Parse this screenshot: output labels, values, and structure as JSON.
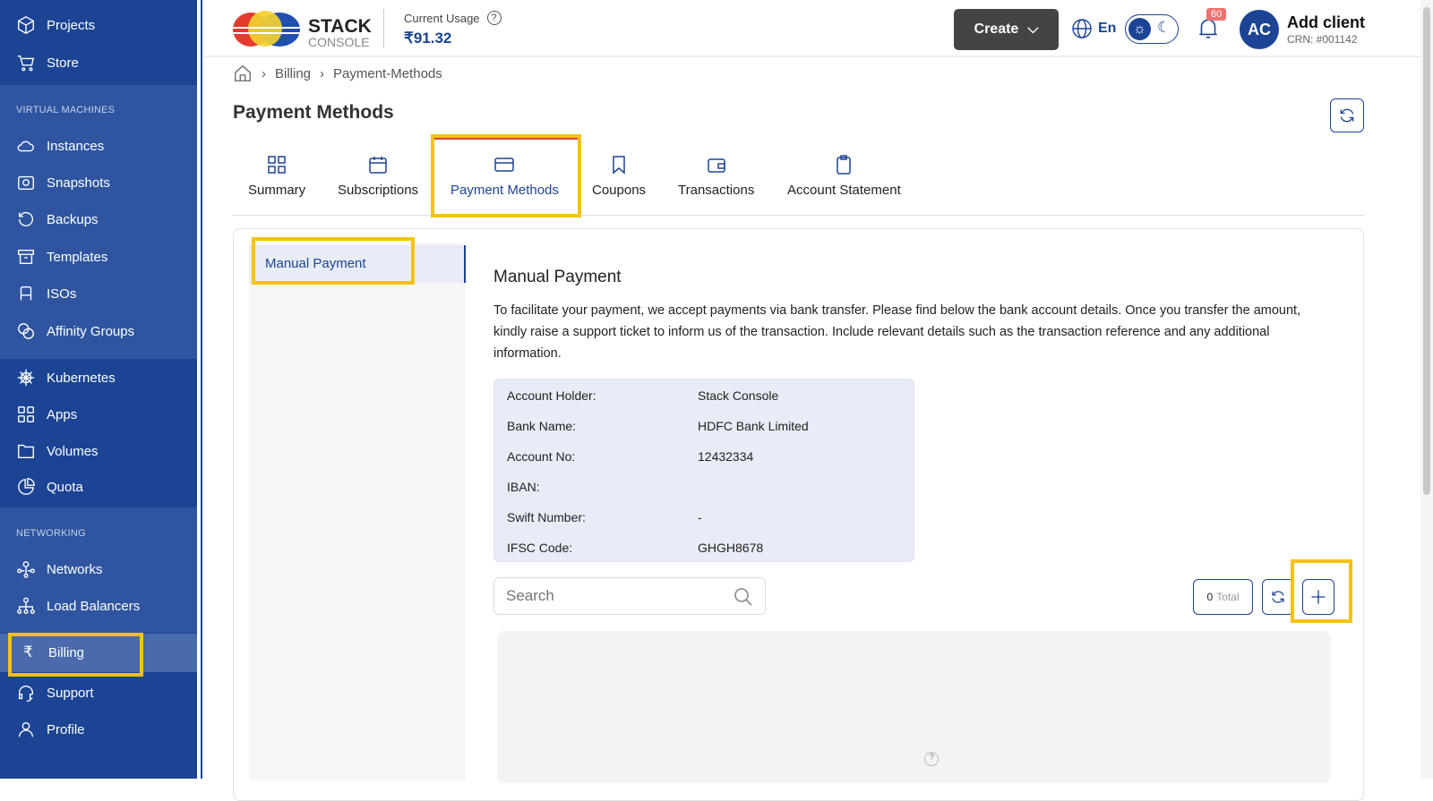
{
  "sidebar": {
    "top_items": [
      {
        "label": "Projects",
        "icon": "cube-icon"
      },
      {
        "label": "Store",
        "icon": "cart-icon"
      }
    ],
    "vm_header": "VIRTUAL MACHINES",
    "vm_items": [
      {
        "label": "Instances"
      },
      {
        "label": "Snapshots"
      },
      {
        "label": "Backups"
      },
      {
        "label": "Templates"
      },
      {
        "label": "ISOs"
      },
      {
        "label": "Affinity Groups"
      }
    ],
    "mid_items": [
      {
        "label": "Kubernetes"
      },
      {
        "label": "Apps"
      },
      {
        "label": "Volumes"
      },
      {
        "label": "Quota"
      }
    ],
    "net_header": "NETWORKING",
    "net_items": [
      {
        "label": "Networks"
      },
      {
        "label": "Load Balancers"
      }
    ],
    "bottom_items": [
      {
        "label": "Billing"
      },
      {
        "label": "Support"
      },
      {
        "label": "Profile"
      }
    ]
  },
  "header": {
    "logo_line1": "STACK",
    "logo_line2": "CONSOLE",
    "usage_label": "Current Usage",
    "usage_value": "₹91.32",
    "create_label": "Create",
    "language": "En",
    "notification_count": "60",
    "avatar_initials": "AC",
    "user_name": "Add client",
    "crn": "CRN: #001142"
  },
  "breadcrumb": [
    "Billing",
    "Payment-Methods"
  ],
  "page_title": "Payment Methods",
  "tabs": [
    {
      "label": "Summary"
    },
    {
      "label": "Subscriptions"
    },
    {
      "label": "Payment Methods"
    },
    {
      "label": "Coupons"
    },
    {
      "label": "Transactions"
    },
    {
      "label": "Account Statement"
    }
  ],
  "side_menu": {
    "item": "Manual Payment"
  },
  "content": {
    "title": "Manual Payment",
    "description": "To facilitate your payment, we accept payments via bank transfer. Please find below the bank account details. Once you transfer the amount, kindly raise a support ticket to inform us of the transaction. Include relevant details such as the transaction reference and any additional information.",
    "bank": [
      {
        "label": "Account Holder:",
        "value": "Stack Console"
      },
      {
        "label": "Bank Name:",
        "value": "HDFC Bank Limited"
      },
      {
        "label": "Account No:",
        "value": "12432334"
      },
      {
        "label": "IBAN:",
        "value": ""
      },
      {
        "label": "Swift Number:",
        "value": "-"
      },
      {
        "label": "IFSC Code:",
        "value": "GHGH8678"
      }
    ],
    "search_placeholder": "Search",
    "total_count": "0",
    "total_label": "Total"
  },
  "colors": {
    "brand": "#1b4494",
    "highlight": "#f5c211"
  }
}
